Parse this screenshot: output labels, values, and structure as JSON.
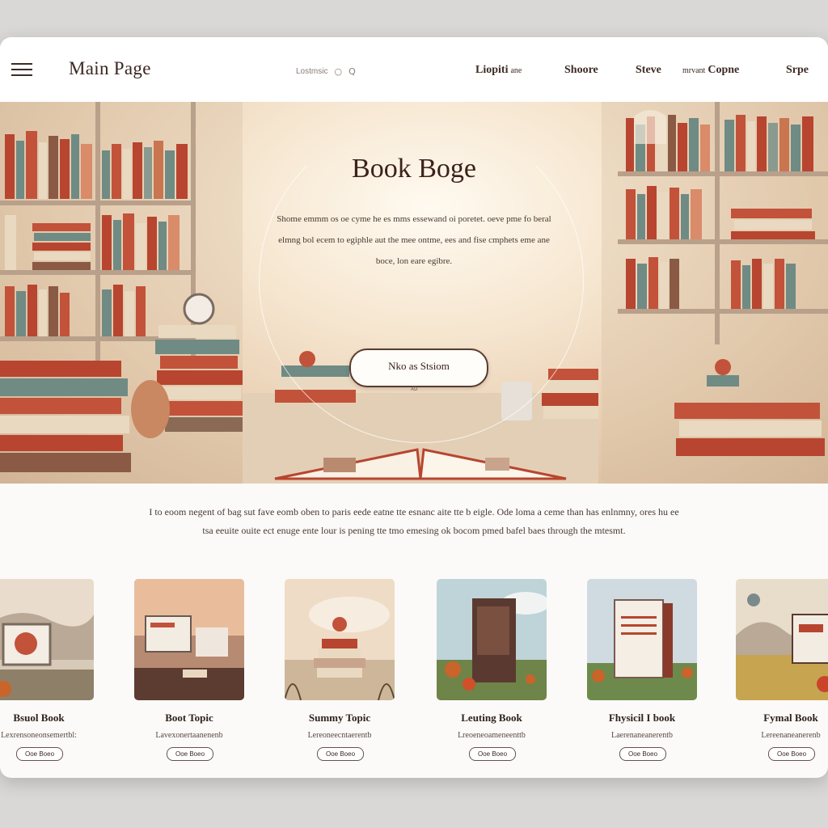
{
  "nav": {
    "brand": "Main Page",
    "search_placeholder": "Lostmsic",
    "links": [
      {
        "label": "Liopiti",
        "small": "ane"
      },
      {
        "label": "Shoore"
      },
      {
        "label": "Steve"
      },
      {
        "label": "Copne",
        "small": "mrvant"
      },
      {
        "label": "Srpe"
      }
    ]
  },
  "hero": {
    "title": "Book Boge",
    "description": "Shome emmm os oe cyme he es mms essewand oi poretet. oeve pme fo beral elmng bol ecem to egiphle aut the mee ontme, ees and fise cmphets eme ane boce, lon eare egibre.",
    "cta_label": "Nko as Stsiom",
    "ornament_text": "ᴀᴅ"
  },
  "intro": {
    "text": "I to eoom negent of bag sut fave eomb oben to paris eede eatne tte esnanc aite tte b eigle. Ode loma a ceme than has enlnmny, ores hu ee tsa eeuite ouite ect enuge ente lour is pening tte tmo emesing ok bocom pmed bafel baes through the mtesmt."
  },
  "cards": [
    {
      "title": "Bsuol Book",
      "subtitle": "Lexrensoneonsemertbl:",
      "button": "Ooe Boeo",
      "icon": "framed-picture-scene"
    },
    {
      "title": "Boot Topic",
      "subtitle": "Lavexonertaanenenb",
      "button": "Ooe Boeo",
      "icon": "computer-desk-scene"
    },
    {
      "title": "Summy Topic",
      "subtitle": "Lereoneecntaerentb",
      "button": "Ooe Boeo",
      "icon": "book-stack-scene"
    },
    {
      "title": "Leuting Book",
      "subtitle": "Lreoeneoameneenttb",
      "button": "Ooe Boeo",
      "icon": "standing-book-scene"
    },
    {
      "title": "Fhysicil I book",
      "subtitle": "Laerenaneanerentb",
      "button": "Ooe Boeo",
      "icon": "open-book-meadow-scene"
    },
    {
      "title": "Fymal Book",
      "subtitle": "Lereenaneanerenb",
      "button": "Ooe Boeo",
      "icon": "field-book-scene"
    }
  ],
  "colors": {
    "accent": "#c2523a",
    "text_dark": "#3a221b",
    "book_red": "#b8452f",
    "book_teal": "#6f8b84",
    "book_cream": "#ead9c1"
  }
}
